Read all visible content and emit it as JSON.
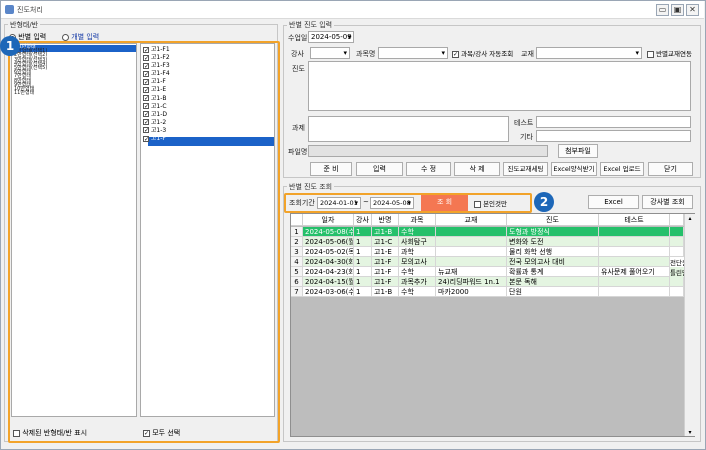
{
  "window": {
    "title": "진도처리",
    "min": "▭",
    "max": "▣",
    "close": "✕"
  },
  "left": {
    "group_title": "반형태/반",
    "radio_class": "반별 입력",
    "radio_individual": "개별 입력",
    "class_types": [
      "고1반형태",
      "1반형태(선택1)",
      "2반형태(선택2)",
      "3반형태(선택3)",
      "4반형태(선택4)",
      "5반형태(선택5)",
      "6반형태",
      "7반형태",
      "8반형태",
      "9반형태",
      "10반형태",
      "11반형태"
    ],
    "classes": [
      "고1-F1",
      "고1-F2",
      "고1-F3",
      "고1-F4",
      "고1-F",
      "고1-E",
      "고1-B",
      "고1-C",
      "고1-D",
      "고1-2",
      "고1-3",
      "고1-F"
    ],
    "show_deleted": "삭제된 반형태/반 표시",
    "select_all": "모두 선택",
    "badge": "1"
  },
  "entry": {
    "group_title": "반별 진도 입력",
    "date_label": "수업일",
    "date_value": "2024-05-09",
    "teacher_label": "강사",
    "subject_label": "과목명",
    "auto_lookup": "과목/강사 자동조회",
    "textbook_label": "교재",
    "textbook_link": "반별교재연동",
    "progress_label": "진도",
    "task_label": "과제",
    "test_label": "테스트",
    "etc_label": "기타",
    "file_label": "파일명",
    "attach": "첨부파일",
    "buttons": [
      "준 비",
      "입력",
      "수 정",
      "삭 제",
      "진도교재세팅",
      "Excel양식받기",
      "Excel 업로드",
      "닫기"
    ]
  },
  "query": {
    "group_title": "반별 진도 조회",
    "period_label": "조회기간",
    "from": "2024-01-01",
    "tilde": "~",
    "to": "2024-05-08",
    "search": "조 회",
    "mine_only": "본인것만",
    "excel": "Excel",
    "by_teacher": "강사별 조회",
    "badge": "2",
    "columns": [
      "일자",
      "강사",
      "반명",
      "과목",
      "교재",
      "진도",
      "테스트"
    ],
    "rows": [
      {
        "no": "1",
        "date": "2024-05-08(수)",
        "t": "1",
        "cls": "고1-B",
        "subj": "수학",
        "book": "",
        "prog": "도형과 방정식",
        "test": ""
      },
      {
        "no": "2",
        "date": "2024-05-06(월)",
        "t": "1",
        "cls": "고1-C",
        "subj": "사회탐구",
        "book": "",
        "prog": "변화와 도전",
        "test": ""
      },
      {
        "no": "3",
        "date": "2024-05-02(목)",
        "t": "1",
        "cls": "고1-E",
        "subj": "과학",
        "book": "",
        "prog": "물리 화학 선행",
        "test": ""
      },
      {
        "no": "4",
        "date": "2024-04-30(화)",
        "t": "1",
        "cls": "고1-F",
        "subj": "모의고사",
        "book": "",
        "prog": "전국 모의고사 대비",
        "test": ""
      },
      {
        "no": "5",
        "date": "2024-04-23(화)",
        "t": "1",
        "cls": "고1-F",
        "subj": "수학",
        "book": "뉴교재",
        "prog": "확률과 통계",
        "test": "유사문제 풀어오기"
      },
      {
        "no": "6",
        "date": "2024-04-15(월)",
        "t": "1",
        "cls": "고1-F",
        "subj": "과목추가",
        "book": "24)리딩파워드 1n.1",
        "prog": "본문 독해",
        "test": ""
      },
      {
        "no": "7",
        "date": "2024-03-06(수)",
        "t": "1",
        "cls": "고1-B",
        "subj": "수학",
        "book": "마카2000",
        "prog": "단원",
        "test": ""
      }
    ],
    "overflow_col": "전단원",
    "overflow_col2": "틀린단"
  }
}
